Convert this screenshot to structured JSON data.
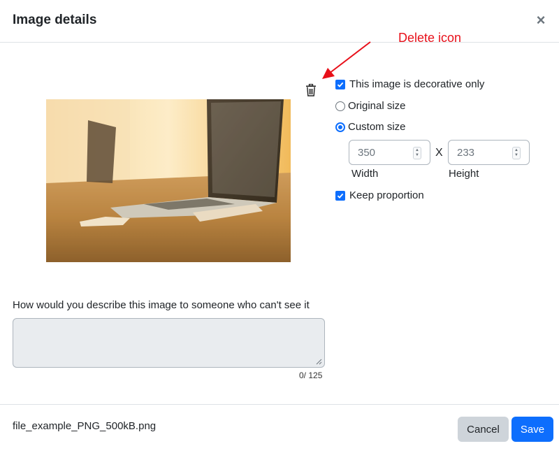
{
  "dialog": {
    "title": "Image details",
    "close_icon": "close-icon"
  },
  "annotation": {
    "text": "Delete icon",
    "color": "#e8101a"
  },
  "image": {
    "delete_icon": "trash-icon"
  },
  "options": {
    "decorative": {
      "label": "This image is decorative only",
      "checked": true
    },
    "original_size": {
      "label": "Original size",
      "selected": false
    },
    "custom_size": {
      "label": "Custom size",
      "selected": true
    },
    "width": {
      "value": "350",
      "label": "Width"
    },
    "separator": "X",
    "height": {
      "value": "233",
      "label": "Height"
    },
    "keep_proportion": {
      "label": "Keep proportion",
      "checked": true
    }
  },
  "description": {
    "label": "How would you describe this image to someone who can't see it",
    "value": "",
    "counter": "0/ 125"
  },
  "footer": {
    "filename": "file_example_PNG_500kB.png",
    "cancel_label": "Cancel",
    "save_label": "Save"
  },
  "colors": {
    "primary": "#0d6efd",
    "secondary": "#ced4da",
    "textarea_bg": "#e9ecef"
  }
}
